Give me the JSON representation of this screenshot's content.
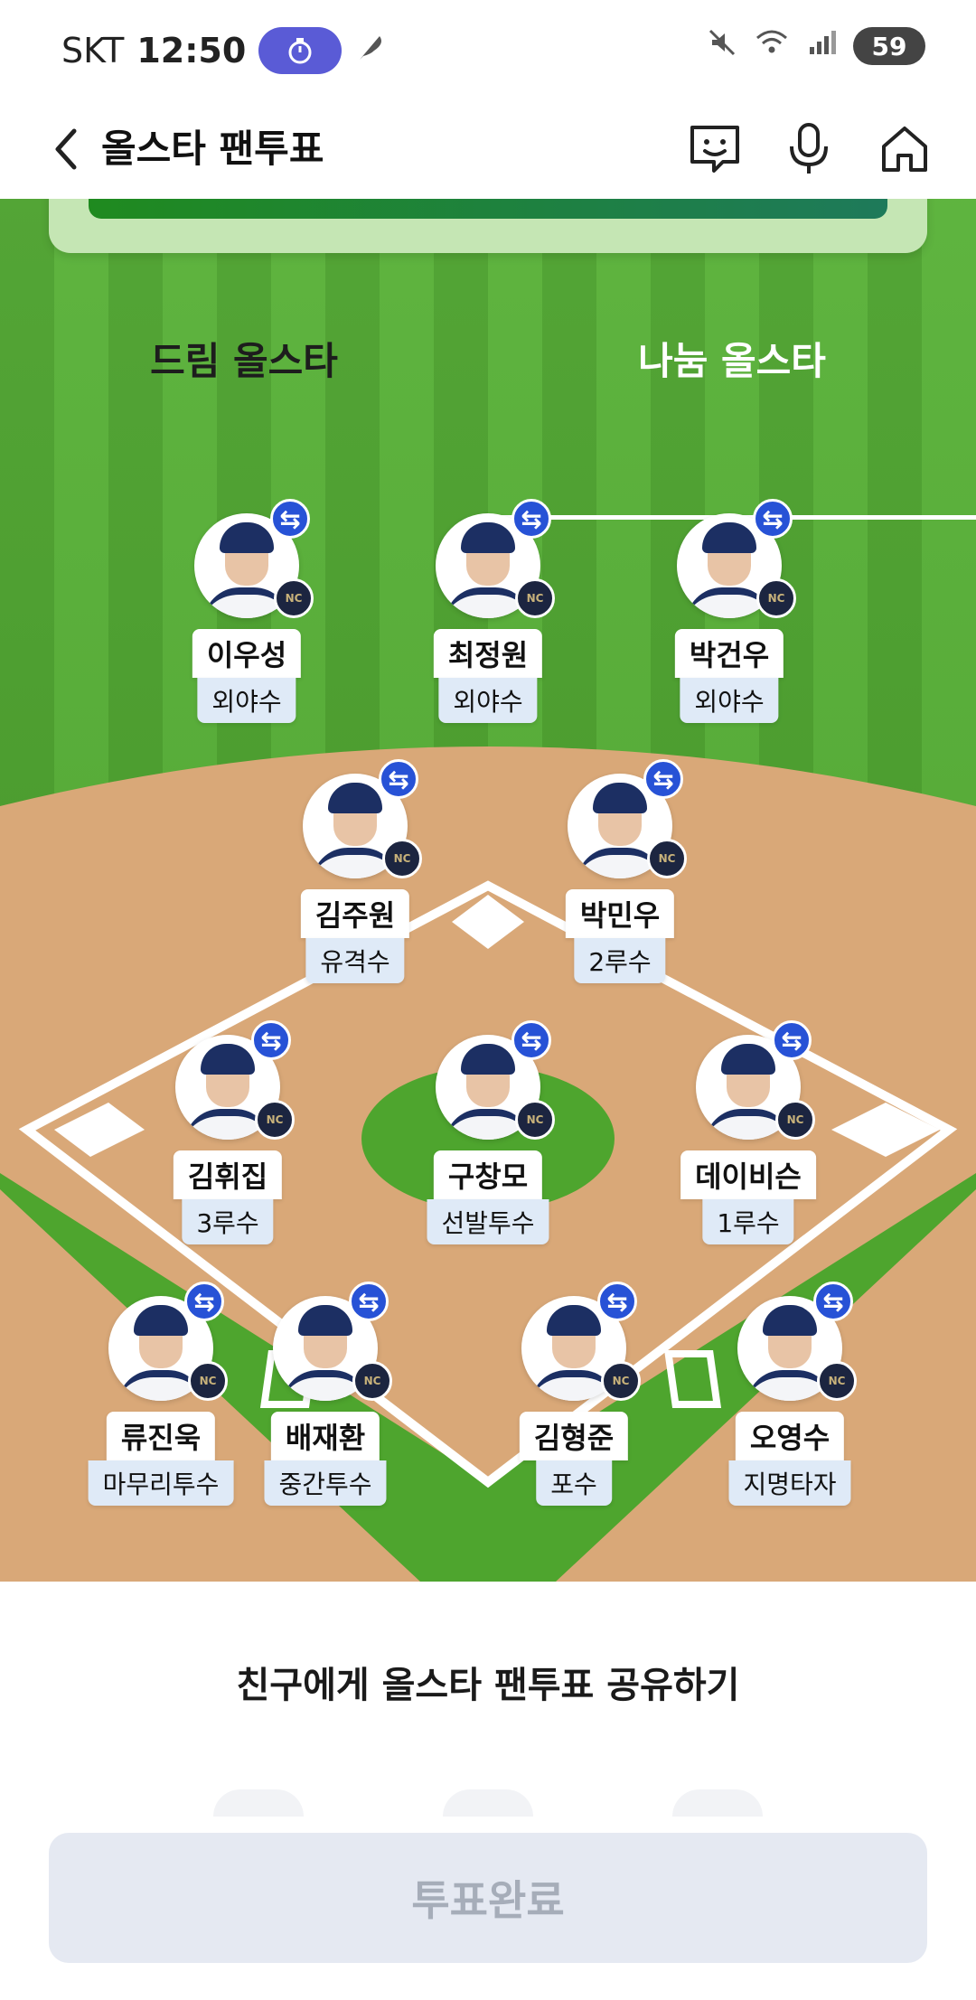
{
  "status_bar": {
    "carrier": "SKT",
    "time": "12:50",
    "battery": "59",
    "icons": [
      "timer-icon",
      "feather-icon",
      "mute-icon",
      "wifi-icon",
      "signal-icon",
      "battery-icon"
    ]
  },
  "header": {
    "title": "올스타 팬투표",
    "icons": [
      "back-icon",
      "chatbot-icon",
      "mic-icon",
      "home-icon"
    ]
  },
  "tabs": [
    {
      "label": "드림 올스타",
      "active": false
    },
    {
      "label": "나눔 올스타",
      "active": true
    }
  ],
  "players": [
    {
      "name": "이우성",
      "position": "외야수"
    },
    {
      "name": "최정원",
      "position": "외야수"
    },
    {
      "name": "박건우",
      "position": "외야수"
    },
    {
      "name": "김주원",
      "position": "유격수"
    },
    {
      "name": "박민우",
      "position": "2루수"
    },
    {
      "name": "김휘집",
      "position": "3루수"
    },
    {
      "name": "구창모",
      "position": "선발투수"
    },
    {
      "name": "데이비슨",
      "position": "1루수"
    },
    {
      "name": "류진욱",
      "position": "마무리투수"
    },
    {
      "name": "배재환",
      "position": "중간투수"
    },
    {
      "name": "김형준",
      "position": "포수"
    },
    {
      "name": "오영수",
      "position": "지명타자"
    }
  ],
  "share": {
    "title": "친구에게 올스타 팬투표 공유하기"
  },
  "vote_button": {
    "label": "투표완료"
  },
  "colors": {
    "field_green": "#4aa02b",
    "infield_dirt": "#dba97a",
    "swap_badge": "#2752d6",
    "team_logo": "#1c2540",
    "timer_pill": "#5a5bd6",
    "vote_button_bg": "#e5e9f2",
    "vote_button_text": "#a6adb9"
  }
}
